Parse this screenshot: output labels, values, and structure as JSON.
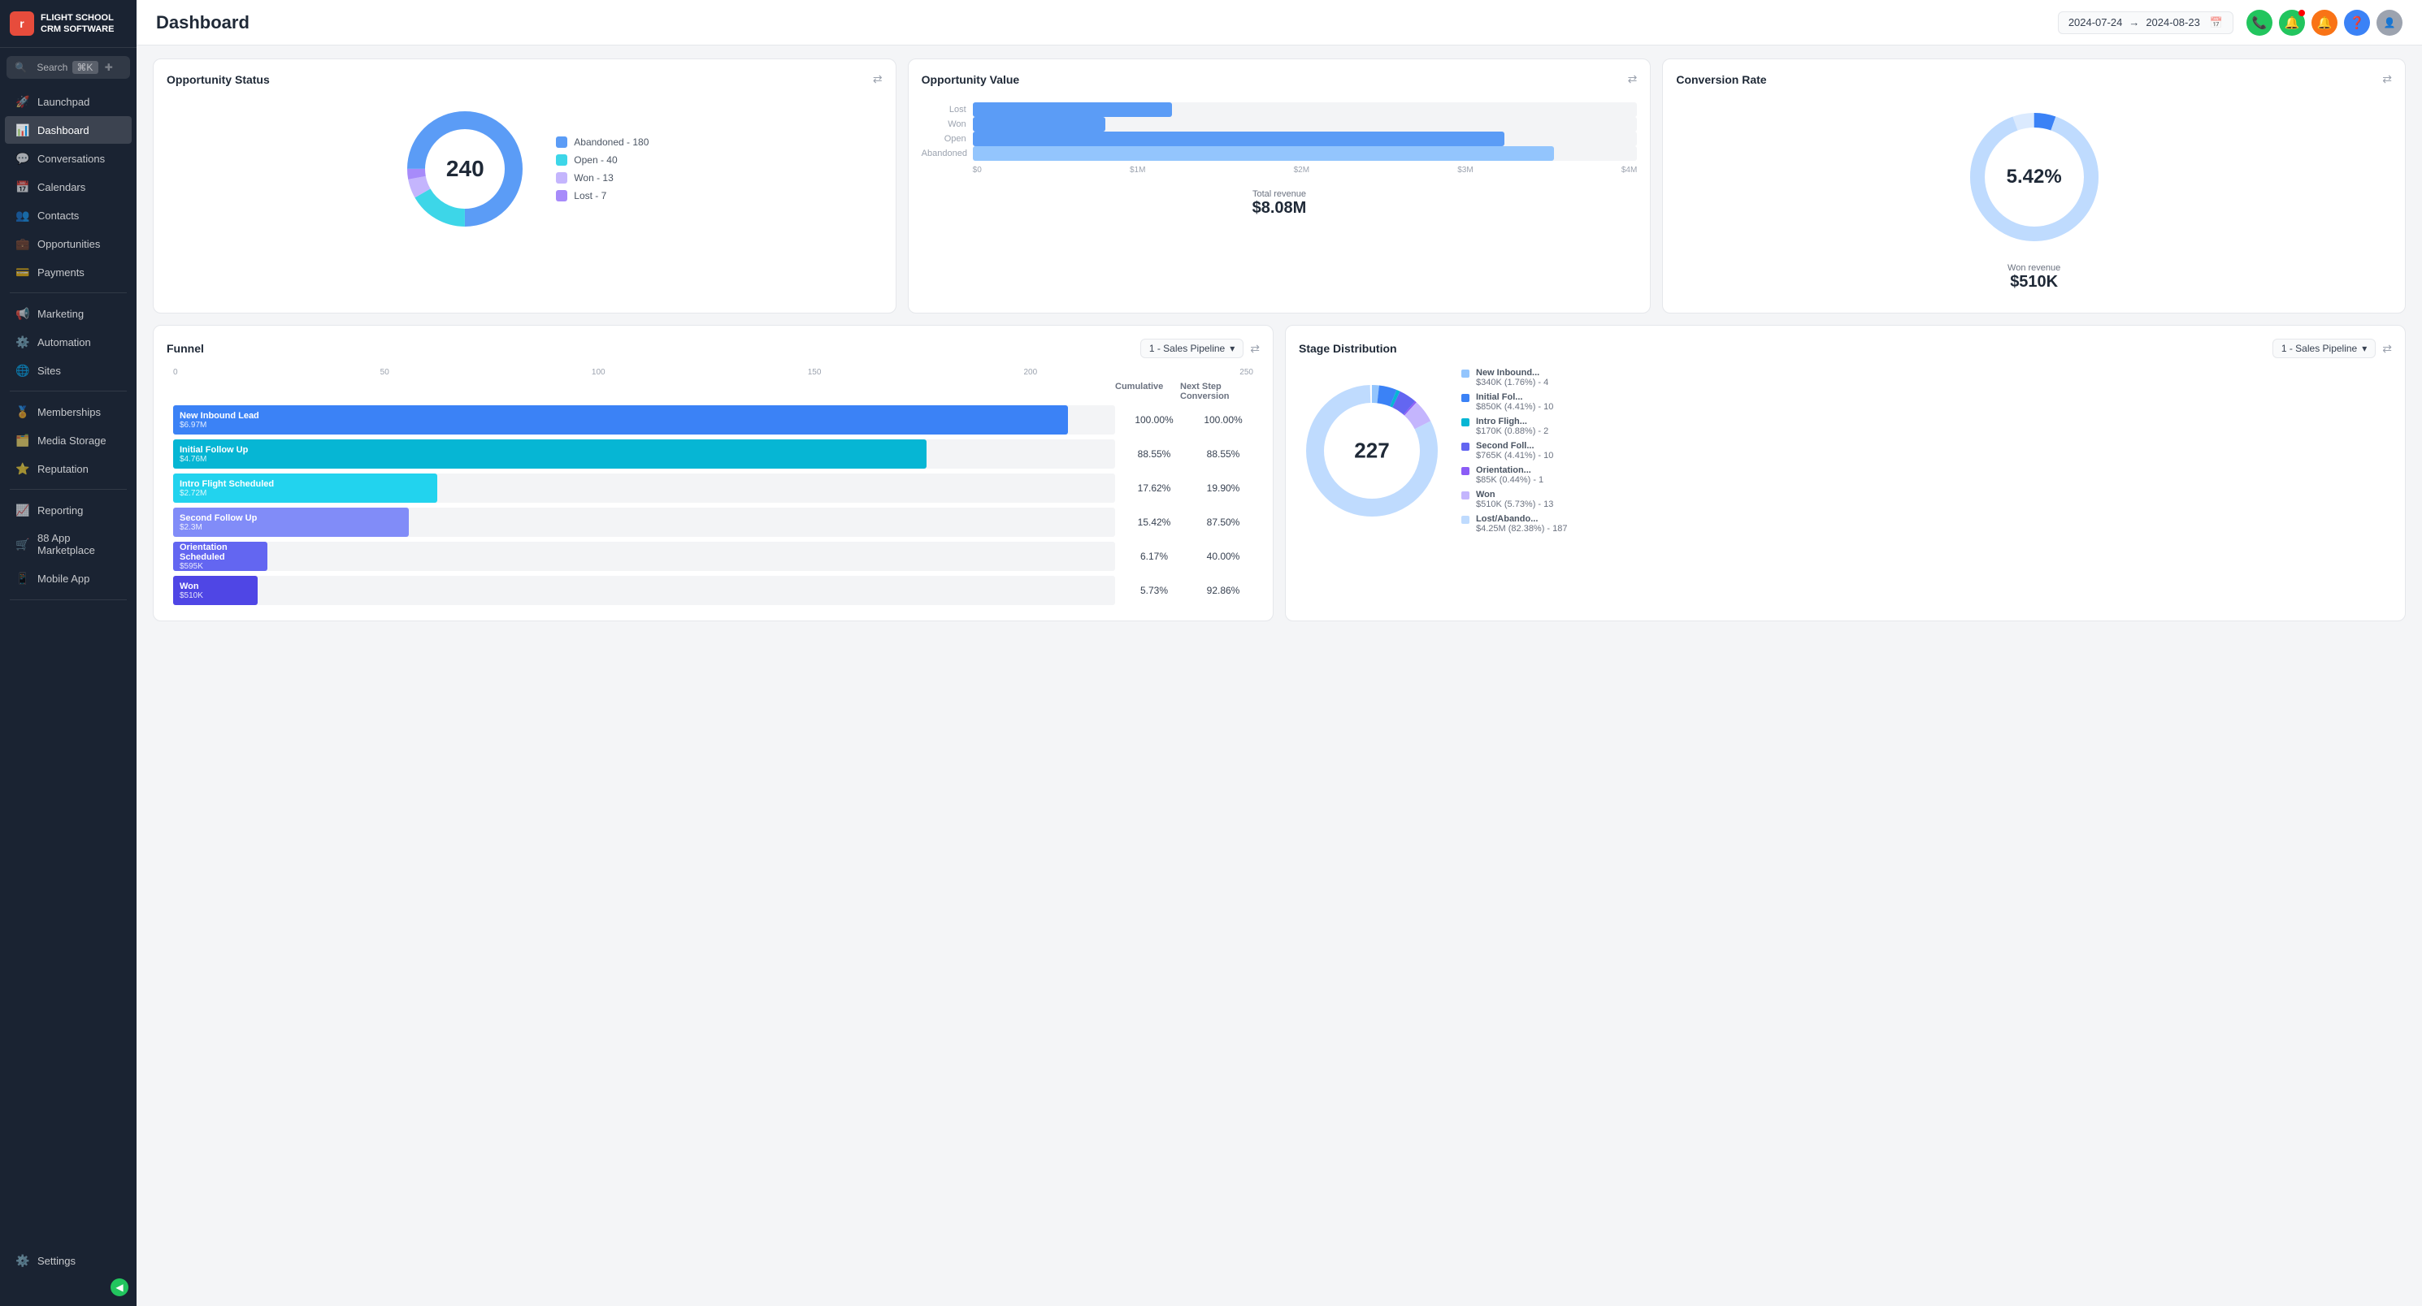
{
  "app": {
    "logo_letter": "r",
    "logo_company": "FLIGHT SCHOOL",
    "logo_sub": "CRM SOFTWARE"
  },
  "search": {
    "placeholder": "Search",
    "shortcut": "⌘K"
  },
  "sidebar": {
    "items": [
      {
        "id": "launchpad",
        "label": "Launchpad",
        "icon": "🚀"
      },
      {
        "id": "dashboard",
        "label": "Dashboard",
        "icon": "📊",
        "active": true
      },
      {
        "id": "conversations",
        "label": "Conversations",
        "icon": "💬"
      },
      {
        "id": "calendars",
        "label": "Calendars",
        "icon": "📅"
      },
      {
        "id": "contacts",
        "label": "Contacts",
        "icon": "👥"
      },
      {
        "id": "opportunities",
        "label": "Opportunities",
        "icon": "💼"
      },
      {
        "id": "payments",
        "label": "Payments",
        "icon": "💳"
      },
      {
        "id": "marketing",
        "label": "Marketing",
        "icon": "📢"
      },
      {
        "id": "automation",
        "label": "Automation",
        "icon": "⚙️"
      },
      {
        "id": "sites",
        "label": "Sites",
        "icon": "🌐"
      },
      {
        "id": "memberships",
        "label": "Memberships",
        "icon": "🏅"
      },
      {
        "id": "media-storage",
        "label": "Media Storage",
        "icon": "🗂️"
      },
      {
        "id": "reputation",
        "label": "Reputation",
        "icon": "⭐"
      },
      {
        "id": "reporting",
        "label": "Reporting",
        "icon": "📈"
      },
      {
        "id": "app-marketplace",
        "label": "88 App Marketplace",
        "icon": "🛒"
      },
      {
        "id": "mobile-app",
        "label": "Mobile App",
        "icon": "📱"
      }
    ],
    "bottom": [
      {
        "id": "settings",
        "label": "Settings",
        "icon": "⚙️"
      }
    ]
  },
  "topbar": {
    "title": "Dashboard",
    "date_from": "2024-07-24",
    "date_arrow": "→",
    "date_to": "2024-08-23"
  },
  "opportunity_status": {
    "title": "Opportunity Status",
    "total": "240",
    "legend": [
      {
        "label": "Abandoned - 180",
        "color": "#5b9cf6"
      },
      {
        "label": "Open - 40",
        "color": "#3dd6e8"
      },
      {
        "label": "Won - 13",
        "color": "#c4b5fd"
      },
      {
        "label": "Lost - 7",
        "color": "#a78bfa"
      }
    ],
    "donut": {
      "segments": [
        {
          "value": 180,
          "color": "#5b9cf6",
          "pct": 75
        },
        {
          "value": 40,
          "color": "#3dd6e8",
          "pct": 16.7
        },
        {
          "value": 13,
          "color": "#c4b5fd",
          "pct": 5.4
        },
        {
          "value": 7,
          "color": "#a78bfa",
          "pct": 2.9
        }
      ]
    }
  },
  "opportunity_value": {
    "title": "Opportunity Value",
    "bars": [
      {
        "label": "Lost",
        "value": 1.2,
        "max": 4,
        "color": "#5b9cf6"
      },
      {
        "label": "Won",
        "value": 0.8,
        "max": 4,
        "color": "#5b9cf6"
      },
      {
        "label": "Open",
        "value": 3.2,
        "max": 4,
        "color": "#5b9cf6"
      },
      {
        "label": "Abandoned",
        "value": 3.5,
        "max": 4,
        "color": "#93c5fd"
      }
    ],
    "axis": [
      "$0",
      "$1M",
      "$2M",
      "$3M",
      "$4M"
    ],
    "total_label": "Total revenue",
    "total_value": "$8.08M"
  },
  "conversion_rate": {
    "title": "Conversion Rate",
    "rate": "5.42%",
    "won_label": "Won revenue",
    "won_value": "$510K"
  },
  "funnel": {
    "title": "Funnel",
    "pipeline": "1 - Sales Pipeline",
    "axis_labels": [
      "0",
      "50",
      "100",
      "150",
      "200",
      "250"
    ],
    "header_cumulative": "Cumulative",
    "header_next": "Next Step Conversion",
    "rows": [
      {
        "name": "New Inbound Lead",
        "value": "$6.97M",
        "color": "#3b82f6",
        "width": 95,
        "cumulative": "100.00%",
        "next": "100.00%"
      },
      {
        "name": "Initial Follow Up",
        "value": "$4.76M",
        "color": "#06b6d4",
        "width": 80,
        "cumulative": "88.55%",
        "next": "88.55%"
      },
      {
        "name": "Intro Flight Scheduled",
        "value": "$2.72M",
        "color": "#22d3ee",
        "width": 28,
        "cumulative": "17.62%",
        "next": "19.90%"
      },
      {
        "name": "Second Follow Up",
        "value": "$2.3M",
        "color": "#818cf8",
        "width": 25,
        "cumulative": "15.42%",
        "next": "87.50%"
      },
      {
        "name": "Orientation Scheduled",
        "value": "$595K",
        "color": "#6366f1",
        "width": 10,
        "cumulative": "6.17%",
        "next": "40.00%"
      },
      {
        "name": "Won",
        "value": "$510K",
        "color": "#4f46e5",
        "width": 9,
        "cumulative": "5.73%",
        "next": "92.86%"
      }
    ]
  },
  "stage_distribution": {
    "title": "Stage Distribution",
    "pipeline": "1 - Sales Pipeline",
    "total": "227",
    "legend": [
      {
        "label": "New Inbound...",
        "sub": "$340K (1.76%) - 4",
        "color": "#93c5fd"
      },
      {
        "label": "Initial Fol...",
        "sub": "$850K (4.41%) - 10",
        "color": "#3b82f6"
      },
      {
        "label": "Intro Fligh...",
        "sub": "$170K (0.88%) - 2",
        "color": "#06b6d4"
      },
      {
        "label": "Second Foll...",
        "sub": "$765K (4.41%) - 10",
        "color": "#6366f1"
      },
      {
        "label": "Orientation...",
        "sub": "$85K (0.44%) - 1",
        "color": "#8b5cf6"
      },
      {
        "label": "Won",
        "sub": "$510K (5.73%) - 13",
        "color": "#c4b5fd"
      },
      {
        "label": "Lost/Abando...",
        "sub": "$4.25M (82.38%) - 187",
        "color": "#bfdbfe"
      }
    ]
  }
}
